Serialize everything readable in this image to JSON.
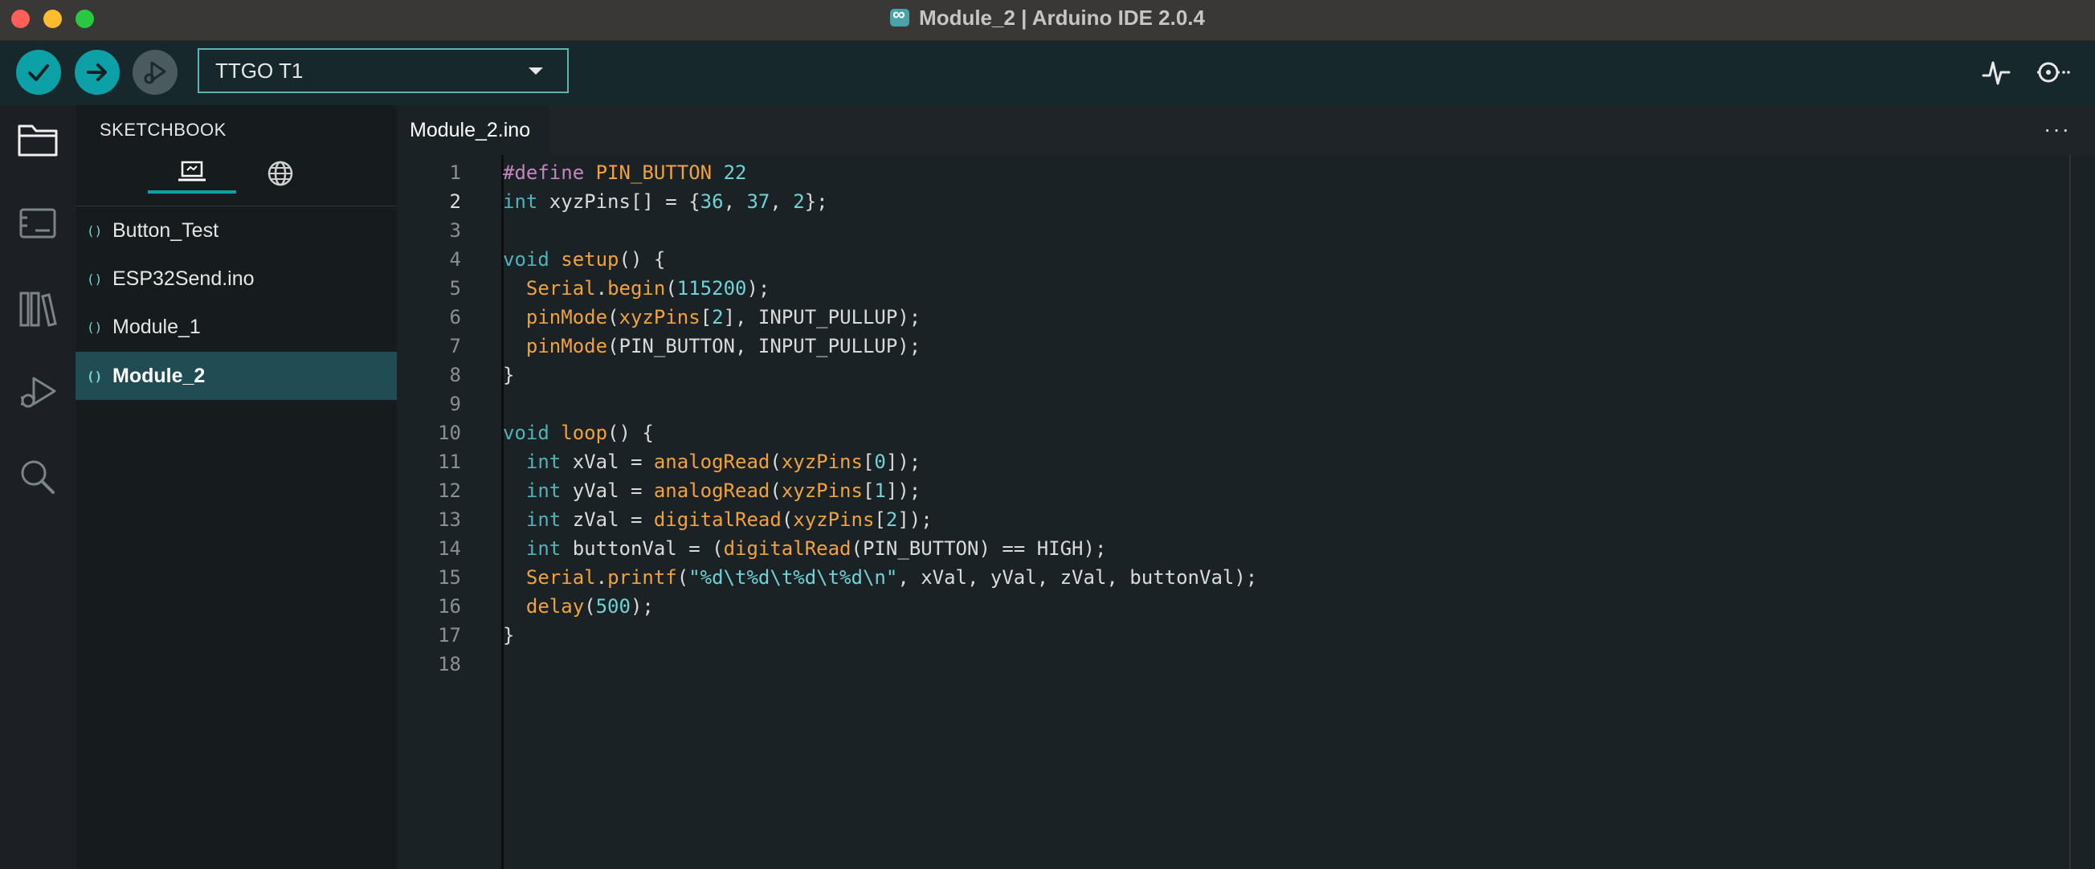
{
  "window": {
    "title": "Module_2 | Arduino IDE 2.0.4"
  },
  "toolbar": {
    "board": "TTGO T1"
  },
  "sidebar": {
    "title": "SKETCHBOOK",
    "items": [
      {
        "label": "Button_Test"
      },
      {
        "label": "ESP32Send.ino"
      },
      {
        "label": "Module_1"
      },
      {
        "label": "Module_2"
      }
    ]
  },
  "editor": {
    "tab": "Module_2.ino",
    "lines": [
      {
        "n": "1",
        "code": "#define PIN_BUTTON 22"
      },
      {
        "n": "2",
        "code": "int xyzPins[] = {36, 37, 2};"
      },
      {
        "n": "3",
        "code": ""
      },
      {
        "n": "4",
        "code": "void setup() {"
      },
      {
        "n": "5",
        "code": "  Serial.begin(115200);"
      },
      {
        "n": "6",
        "code": "  pinMode(xyzPins[2], INPUT_PULLUP);"
      },
      {
        "n": "7",
        "code": "  pinMode(PIN_BUTTON, INPUT_PULLUP);"
      },
      {
        "n": "8",
        "code": "}"
      },
      {
        "n": "9",
        "code": ""
      },
      {
        "n": "10",
        "code": "void loop() {"
      },
      {
        "n": "11",
        "code": "  int xVal = analogRead(xyzPins[0]);"
      },
      {
        "n": "12",
        "code": "  int yVal = analogRead(xyzPins[1]);"
      },
      {
        "n": "13",
        "code": "  int zVal = digitalRead(xyzPins[2]);"
      },
      {
        "n": "14",
        "code": "  int buttonVal = (digitalRead(PIN_BUTTON) == HIGH);"
      },
      {
        "n": "15",
        "code": "  Serial.printf(\"%d\\t%d\\t%d\\t%d\\n\", xVal, yVal, zVal, buttonVal);"
      },
      {
        "n": "16",
        "code": "  delay(500);"
      },
      {
        "n": "17",
        "code": "}"
      },
      {
        "n": "18",
        "code": ""
      }
    ]
  },
  "colors": {
    "accent": "#0ca1a6",
    "toolbar_bg": "#16282c",
    "editor_bg": "#1b2226",
    "keyword_orange": "#f1a23c",
    "type_teal": "#4fb3b8",
    "number_cyan": "#6fd3d6",
    "directive_pink": "#c586c0"
  },
  "icons": {
    "verify": "check-icon",
    "upload": "arrow-right-icon",
    "debug": "debug-icon",
    "serial_plotter": "pulse-icon",
    "serial_monitor": "magnifier-dots-icon",
    "sketchbook": "folder-icon",
    "boards": "board-icon",
    "library": "library-icon",
    "debug_panel": "bug-play-icon",
    "search": "search-icon",
    "local_sketches": "laptop-icon",
    "cloud_sketches": "globe-icon"
  }
}
